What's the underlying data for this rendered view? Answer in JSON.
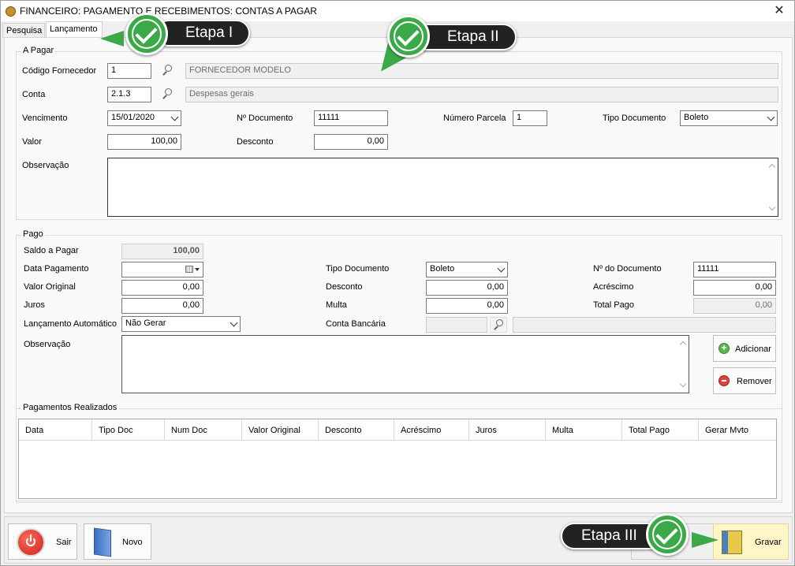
{
  "window": {
    "title": "FINANCEIRO: PAGAMENTO E RECEBIMENTOS: CONTAS A PAGAR",
    "close_glyph": "✕",
    "app_icon": "coin-icon"
  },
  "tabs": [
    {
      "label": "Pesquisa",
      "active": false
    },
    {
      "label": "Lançamento",
      "active": true
    }
  ],
  "a_pagar": {
    "legend": "A Pagar",
    "codigo_fornecedor": {
      "label": "Código Fornecedor",
      "value": "1",
      "name": "FORNECEDOR MODELO"
    },
    "conta": {
      "label": "Conta",
      "value": "2.1.3",
      "name": "Despesas gerais"
    },
    "vencimento": {
      "label": "Vencimento",
      "value": "15/01/2020"
    },
    "num_documento": {
      "label": "Nº Documento",
      "value": "11111"
    },
    "num_parcela": {
      "label": "Número Parcela",
      "value": "1"
    },
    "tipo_documento": {
      "label": "Tipo Documento",
      "value": "Boleto"
    },
    "valor": {
      "label": "Valor",
      "value": "100,00"
    },
    "desconto": {
      "label": "Desconto",
      "value": "0,00"
    },
    "observacao": {
      "label": "Observação",
      "value": ""
    }
  },
  "pago": {
    "legend": "Pago",
    "saldo_a_pagar": {
      "label": "Saldo a Pagar",
      "value": "100,00"
    },
    "data_pagamento": {
      "label": "Data Pagamento",
      "value": ""
    },
    "valor_original": {
      "label": "Valor Original",
      "value": "0,00"
    },
    "juros": {
      "label": "Juros",
      "value": "0,00"
    },
    "lancamento_automatico": {
      "label": "Lançamento Automático",
      "value": "Não Gerar"
    },
    "observacao": {
      "label": "Observação",
      "value": ""
    },
    "tipo_documento": {
      "label": "Tipo Documento",
      "value": "Boleto"
    },
    "desconto": {
      "label": "Desconto",
      "value": "0,00"
    },
    "multa": {
      "label": "Multa",
      "value": "0,00"
    },
    "conta_bancaria": {
      "label": "Conta Bancária",
      "value": "",
      "name": ""
    },
    "num_documento": {
      "label": "Nº do Documento",
      "value": "11111"
    },
    "acrescimo": {
      "label": "Acréscimo",
      "value": "0,00"
    },
    "total_pago": {
      "label": "Total Pago",
      "value": "0,00"
    },
    "adicionar_label": "Adicionar",
    "remover_label": "Remover"
  },
  "pagamentos_realizados": {
    "legend": "Pagamentos Realizados",
    "columns": [
      "Data",
      "Tipo Doc",
      "Num Doc",
      "Valor Original",
      "Desconto",
      "Acréscimo",
      "Juros",
      "Multa",
      "Total Pago",
      "Gerar Mvto"
    ],
    "rows": []
  },
  "footer": {
    "sair_label": "Sair",
    "novo_label": "Novo",
    "gravar_label": "Gravar"
  },
  "annotations": {
    "etapa1": "Etapa I",
    "etapa2": "Etapa II",
    "etapa3": "Etapa III",
    "accent_color": "#3ba948"
  }
}
